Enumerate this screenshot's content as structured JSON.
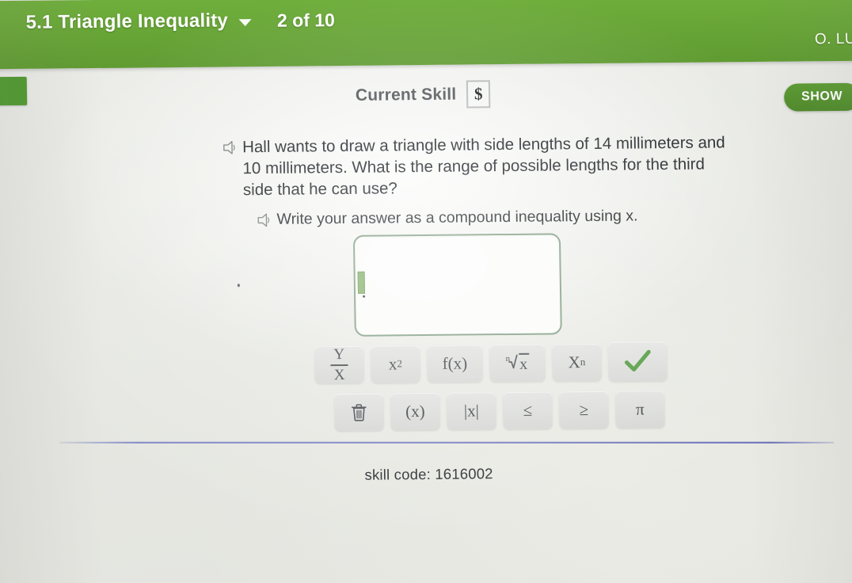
{
  "appbar": {
    "skill_title": "5.1 Triangle Inequality",
    "dropdown_icon": "chevron-down-icon",
    "progress": "2 of 10",
    "user_name": "O. LU",
    "color": "#67a436"
  },
  "subheader": {
    "current_skill_label": "Current Skill",
    "money_icon": "dollar-sign-icon",
    "money_symbol": "$",
    "show_button": "SHOW"
  },
  "question": {
    "audio_icon": "speaker-icon",
    "prompt": "Hall wants to draw a triangle with side lengths of 14 millimeters and 10 millimeters. What is the range of possible lengths for the third side that he can use?",
    "instruction": "Write your answer as a compound inequality using x."
  },
  "answer": {
    "value": "",
    "placeholder": ""
  },
  "keypad": {
    "row1": [
      {
        "name": "fraction-key",
        "label": "Y/X",
        "numerator": "Y",
        "denominator": "X",
        "kind": "fraction"
      },
      {
        "name": "square-key",
        "label": "x²",
        "base": "x",
        "exponent": "2",
        "kind": "superscript"
      },
      {
        "name": "function-key",
        "label": "f(x)",
        "kind": "text"
      },
      {
        "name": "nth-root-key",
        "label": "ⁿ√x",
        "index": "n",
        "radicand": "x",
        "kind": "radical"
      },
      {
        "name": "subscript-key",
        "label": "Xn",
        "base": "X",
        "subscript": "n",
        "kind": "subscript"
      },
      {
        "name": "submit-check-key",
        "label": "✓",
        "kind": "check",
        "color": "#4f9a3e"
      }
    ],
    "row2": [
      {
        "name": "delete-key",
        "label": "trash",
        "kind": "trash"
      },
      {
        "name": "parentheses-key",
        "label": "(x)",
        "kind": "text"
      },
      {
        "name": "absolute-value-key",
        "label": "|x|",
        "kind": "text"
      },
      {
        "name": "less-than-equal-key",
        "label": "≤",
        "kind": "text"
      },
      {
        "name": "greater-than-equal-key",
        "label": "≥",
        "kind": "text"
      },
      {
        "name": "pi-key",
        "label": "π",
        "kind": "text"
      }
    ]
  },
  "footer": {
    "skill_code": "skill code: 1616002"
  }
}
